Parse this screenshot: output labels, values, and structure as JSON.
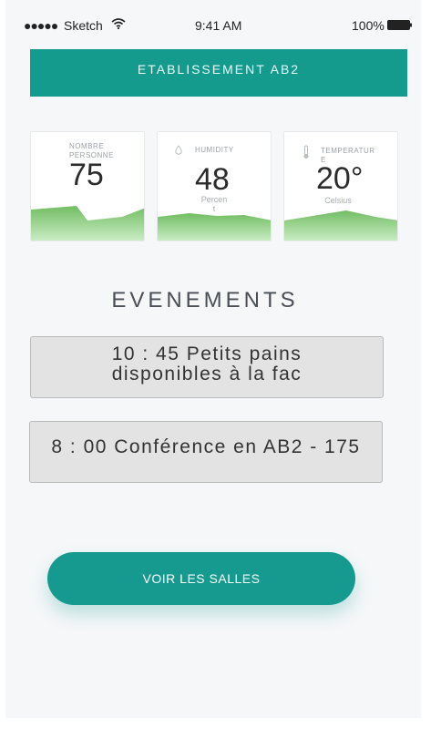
{
  "status_bar": {
    "signal": "●●●●●",
    "carrier": "Sketch",
    "time": "9:41 AM",
    "battery": "100%"
  },
  "header": {
    "title": "ETABLISSEMENT AB2"
  },
  "metrics": [
    {
      "label_line1": "NOMBRE",
      "label_line2": "PERSONNE",
      "value": "75",
      "unit_line1": "",
      "unit_line2": ""
    },
    {
      "label_line1": "HUMIDITY",
      "label_line2": "",
      "value": "48",
      "unit_line1": "Percen",
      "unit_line2": "t",
      "icon": "droplet-icon"
    },
    {
      "label_line1": "TEMPERATUR",
      "label_line2": "E",
      "value": "20°",
      "unit_line1": "Celsius",
      "unit_line2": "",
      "icon": "thermometer-icon"
    }
  ],
  "events": {
    "title": "EVENEMENTS",
    "items": [
      {
        "line1": "10 : 45 Petits pains",
        "line2": "disponibles à la fac"
      },
      {
        "line1": "8 : 00 Conférence en AB2 - 175",
        "line2": ""
      }
    ]
  },
  "cta": {
    "label": "VOIR LES SALLES"
  },
  "colors": {
    "accent": "#159a8e",
    "chart_green": "#7cc36f"
  }
}
